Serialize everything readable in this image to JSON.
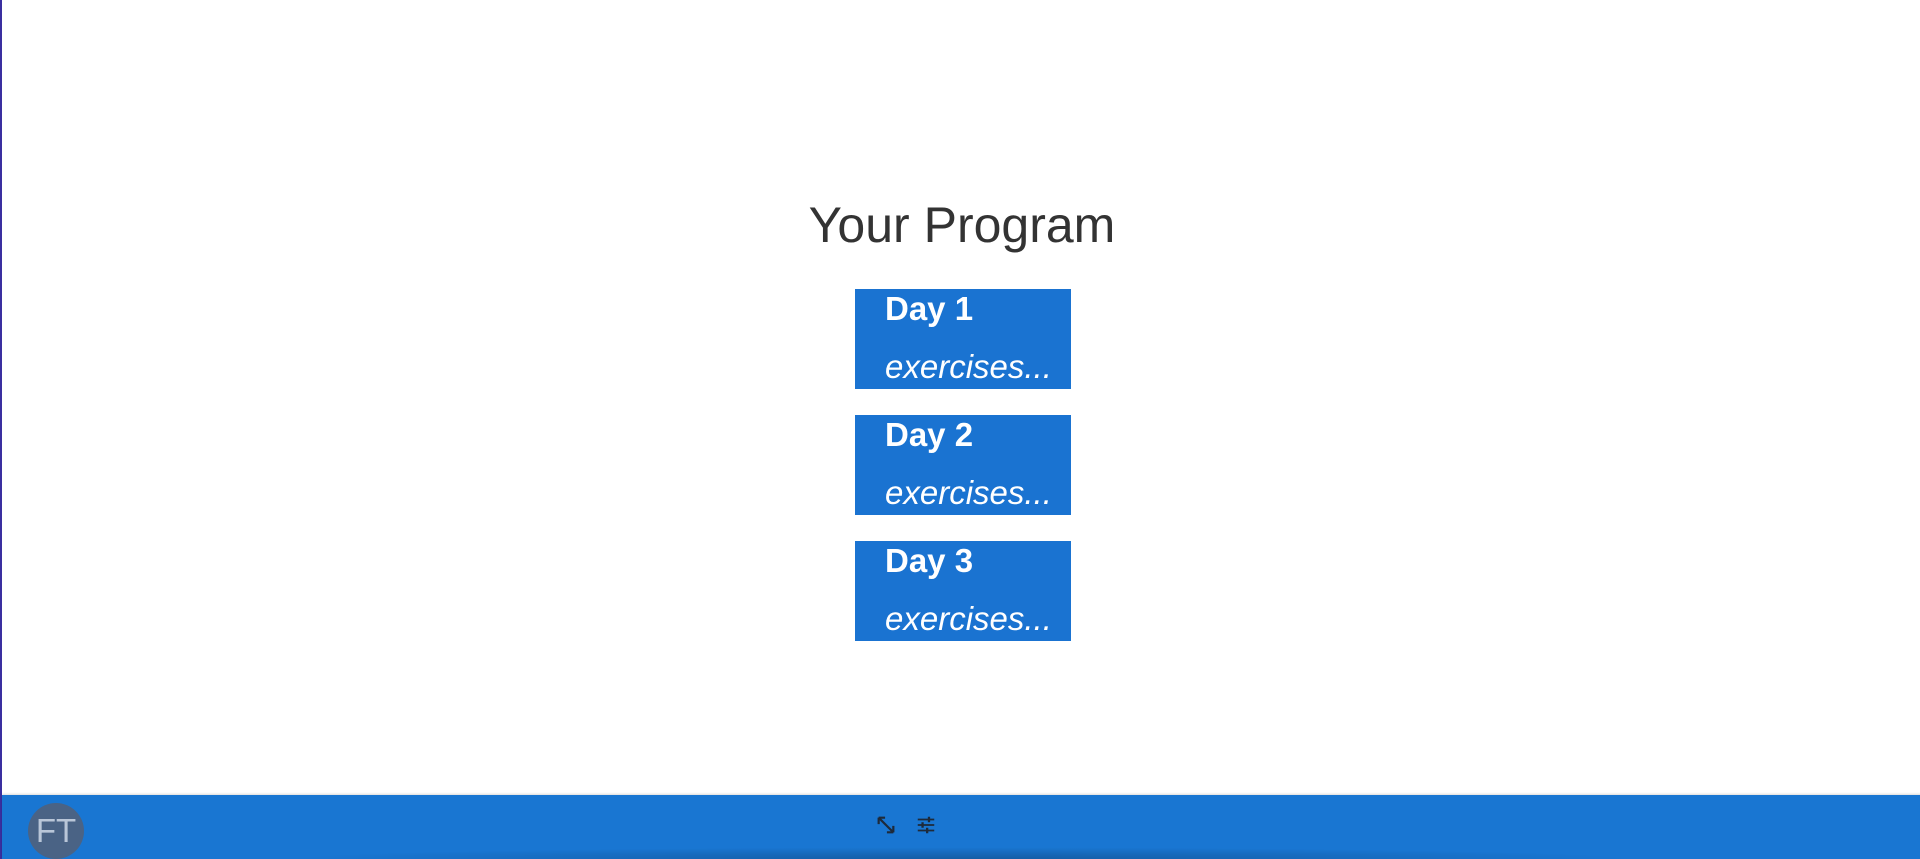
{
  "page": {
    "title": "Your Program"
  },
  "days": [
    {
      "title": "Day 1",
      "subtitle": "exercises..."
    },
    {
      "title": "Day 2",
      "subtitle": "exercises..."
    },
    {
      "title": "Day 3",
      "subtitle": "exercises..."
    }
  ],
  "bottom_bar": {
    "avatar_initials": "FT",
    "icons": [
      "expand-icon",
      "tune-icon"
    ]
  },
  "colors": {
    "primary": "#1976d2",
    "card": "#1a73d1",
    "avatar": "#4a6385",
    "title_text": "#333333"
  }
}
